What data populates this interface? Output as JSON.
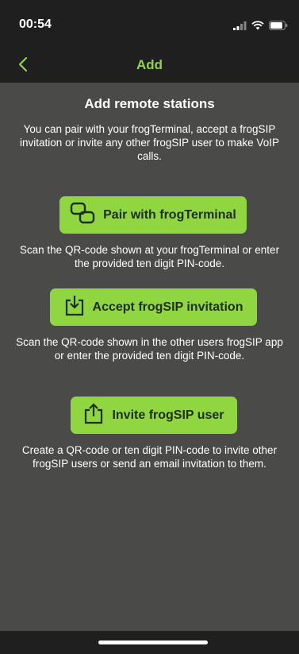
{
  "status": {
    "time": "00:54",
    "icons": [
      "signal-icon",
      "wifi-icon",
      "battery-icon"
    ]
  },
  "nav": {
    "title": "Add",
    "back_icon": "chevron-left-icon"
  },
  "main": {
    "heading": "Add remote stations",
    "intro": "You can pair with your frogTerminal, accept a frogSIP invitation or invite any other frogSIP user to make VoIP calls.",
    "actions": [
      {
        "label": "Pair with frogTerminal",
        "icon": "link-icon",
        "description": "Scan the QR-code shown at your frogTerminal or enter the provided ten digit PIN-code."
      },
      {
        "label": "Accept frogSIP invitation",
        "icon": "download-icon",
        "description": "Scan the QR-code shown in the other users frogSIP app or enter the provided ten digit PIN-code."
      },
      {
        "label": "Invite frogSIP user",
        "icon": "share-icon",
        "description": "Create a QR-code or ten digit PIN-code to invite other frogSIP users or send an email invitation to them."
      }
    ]
  },
  "colors": {
    "accent": "#8fd640",
    "background": "#4a4a48",
    "bar": "#1f1f1f"
  }
}
